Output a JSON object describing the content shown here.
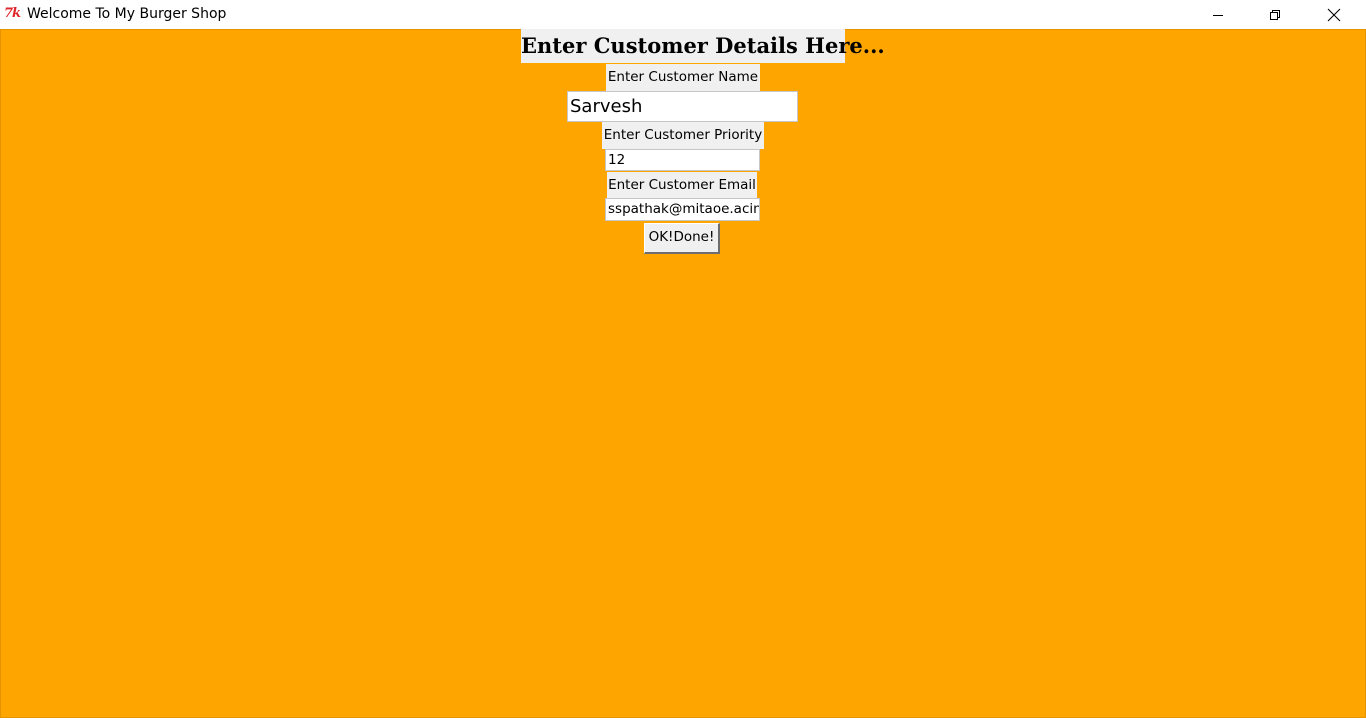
{
  "window": {
    "title": "Welcome To My Burger Shop",
    "icon_text": "7k",
    "background": "#ffa500"
  },
  "controls": {
    "minimize": "minimize-icon",
    "restore": "restore-icon",
    "close": "close-icon"
  },
  "form": {
    "heading": "Enter Customer Details Here...",
    "name_label": "Enter Customer Name",
    "name_value": "Sarvesh",
    "priority_label": "Enter Customer Priority",
    "priority_value": "12",
    "email_label": "Enter Customer Email",
    "email_value": "sspathak@mitaoe.acin",
    "submit_label": "OK!Done!"
  }
}
